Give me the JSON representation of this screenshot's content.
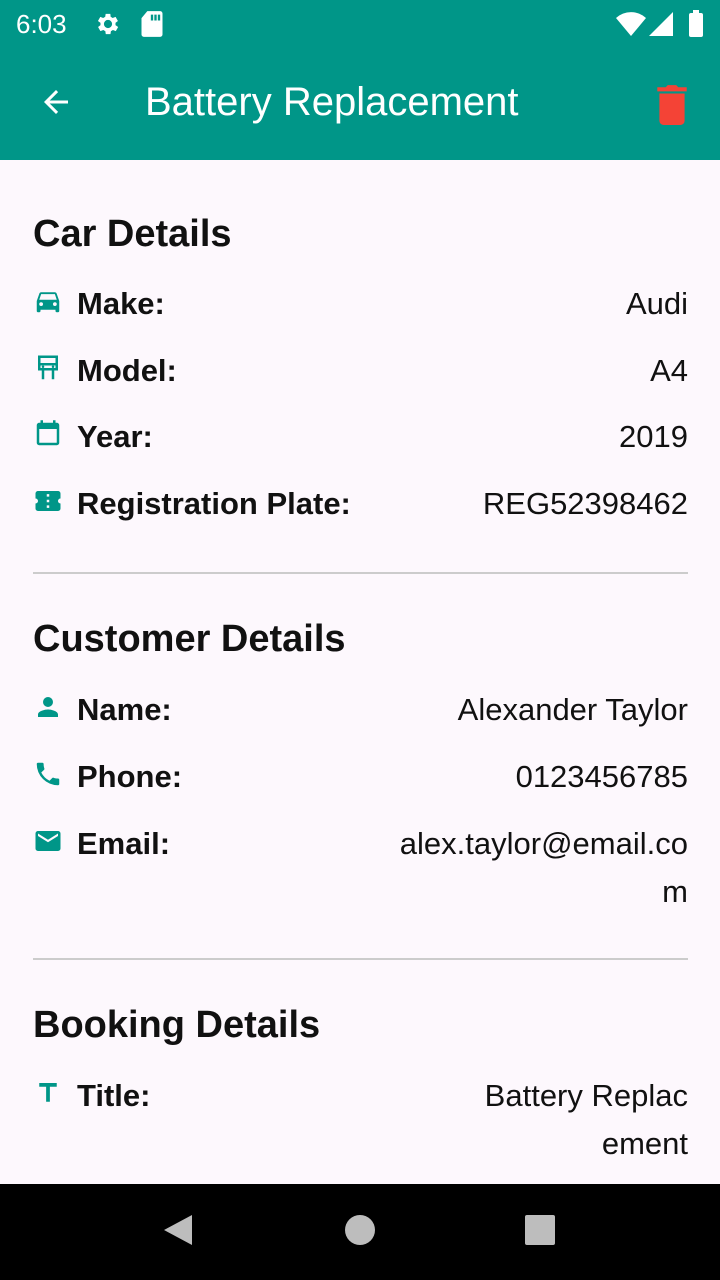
{
  "status_bar": {
    "time": "6:03",
    "icons": [
      "settings-icon",
      "sd-card-icon",
      "wifi-icon",
      "signal-icon",
      "battery-icon"
    ]
  },
  "app_bar": {
    "title": "Battery Replacement",
    "back_icon": "arrow-back-icon",
    "delete_icon": "trash-icon",
    "background_color": "#009688",
    "delete_color": "#f44336"
  },
  "sections": {
    "car": {
      "heading": "Car Details",
      "rows": [
        {
          "icon": "car-icon",
          "label": "Make:",
          "value": "Audi"
        },
        {
          "icon": "car-side-icon",
          "label": "Model:",
          "value": "A4"
        },
        {
          "icon": "calendar-icon",
          "label": "Year:",
          "value": "2019"
        },
        {
          "icon": "plate-icon",
          "label": "Registration Plate:",
          "value": "REG52398462"
        }
      ]
    },
    "customer": {
      "heading": "Customer Details",
      "rows": [
        {
          "icon": "person-icon",
          "label": "Name:",
          "value": "Alexander Taylor"
        },
        {
          "icon": "phone-icon",
          "label": "Phone:",
          "value": "0123456785"
        },
        {
          "icon": "email-icon",
          "label": "Email:",
          "value": "alex.taylor@email.com"
        }
      ]
    },
    "booking": {
      "heading": "Booking Details",
      "rows": [
        {
          "icon": "title-icon",
          "label": "Title:",
          "value": "Battery Replacement"
        }
      ]
    }
  },
  "accent_color": "#009688",
  "nav_bar": {
    "icons": [
      "back-triangle-icon",
      "home-circle-icon",
      "recents-square-icon"
    ]
  }
}
